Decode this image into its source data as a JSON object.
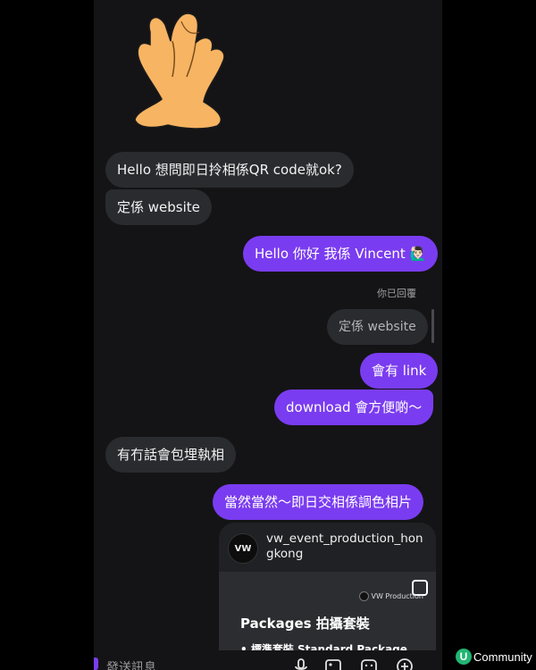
{
  "messages": {
    "in_1": "Hello 想問即日拎相係QR code就ok?",
    "in_2": "定係 website",
    "out_1": "Hello 你好 我係 Vincent",
    "out_1_emoji": "🙋🏻‍♂️",
    "replied_label": "你已回覆",
    "replied_quote": "定係 website",
    "out_2": "會有 link",
    "out_3": "download 會方便啲～",
    "in_3": "有冇話會包埋執相",
    "out_4": "當然當然～即日交相係調色相片"
  },
  "shared_post": {
    "avatar_text": "VW",
    "handle": "vw_event_production_hongkong",
    "brand": "VW Production",
    "title": "Packages 拍攝套裝",
    "bullet": "• 標準套裝 Standard Package"
  },
  "composer": {
    "placeholder": "發送訊息"
  },
  "icons": [
    "hand-sticker-icon",
    "mic-icon",
    "image-icon",
    "sticker-icon",
    "plus-icon"
  ],
  "watermark": {
    "letter": "U",
    "text": "Community"
  },
  "colors": {
    "outgoing_bubble": "#7a3cf0",
    "incoming_bubble": "#2a2b2f",
    "background": "#141416"
  }
}
